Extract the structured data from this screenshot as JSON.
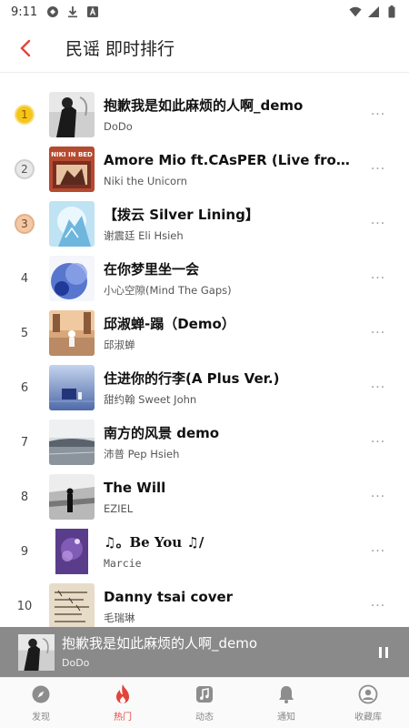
{
  "status_bar": {
    "time": "9:11"
  },
  "header": {
    "title": "民谣 即时排行"
  },
  "songs": [
    {
      "rank": "1",
      "title": "抱歉我是如此麻烦的人啊_demo",
      "artist": "DoDo"
    },
    {
      "rank": "2",
      "title": "Amore Mio ft.CAsPER (Live from Niki's Bedroom)",
      "artist": "Niki the Unicorn"
    },
    {
      "rank": "3",
      "title": "【拨云 Silver Lining】",
      "artist": "谢震廷 Eli Hsieh"
    },
    {
      "rank": "4",
      "title": "在你梦里坐一会",
      "artist": "小心空隙(Mind The Gaps)"
    },
    {
      "rank": "5",
      "title": "邱淑蝉-蹋（Demo）",
      "artist": "邱淑蝉"
    },
    {
      "rank": "6",
      "title": "住进你的行李(A Plus Ver.)",
      "artist": "甜约翰 Sweet John"
    },
    {
      "rank": "7",
      "title": "南方的风景 demo",
      "artist": "沛普 Pep Hsieh"
    },
    {
      "rank": "8",
      "title": "The Will",
      "artist": "EZIEL"
    },
    {
      "rank": "9",
      "title": "♫。Be You ♫/",
      "artist": "Marcie"
    },
    {
      "rank": "10",
      "title": "Danny tsai cover",
      "artist": "毛瑞琳"
    }
  ],
  "cover_labels": {
    "song2": "NIKI IN BED"
  },
  "more_label": "···",
  "player": {
    "title": "抱歉我是如此麻烦的人啊_demo",
    "artist": "DoDo",
    "state": "playing"
  },
  "nav": [
    {
      "label": "发现",
      "icon": "compass-icon",
      "active": false
    },
    {
      "label": "热门",
      "icon": "flame-icon",
      "active": true
    },
    {
      "label": "动态",
      "icon": "music-note-icon",
      "active": false
    },
    {
      "label": "通知",
      "icon": "bell-icon",
      "active": false
    },
    {
      "label": "收藏库",
      "icon": "user-circle-icon",
      "active": false
    }
  ],
  "colors": {
    "accent": "#e2453c",
    "gold": "#f2b705",
    "silver": "#b9b9b9",
    "bronze": "#d79a6c",
    "player_bg": "#8a8a8a"
  }
}
